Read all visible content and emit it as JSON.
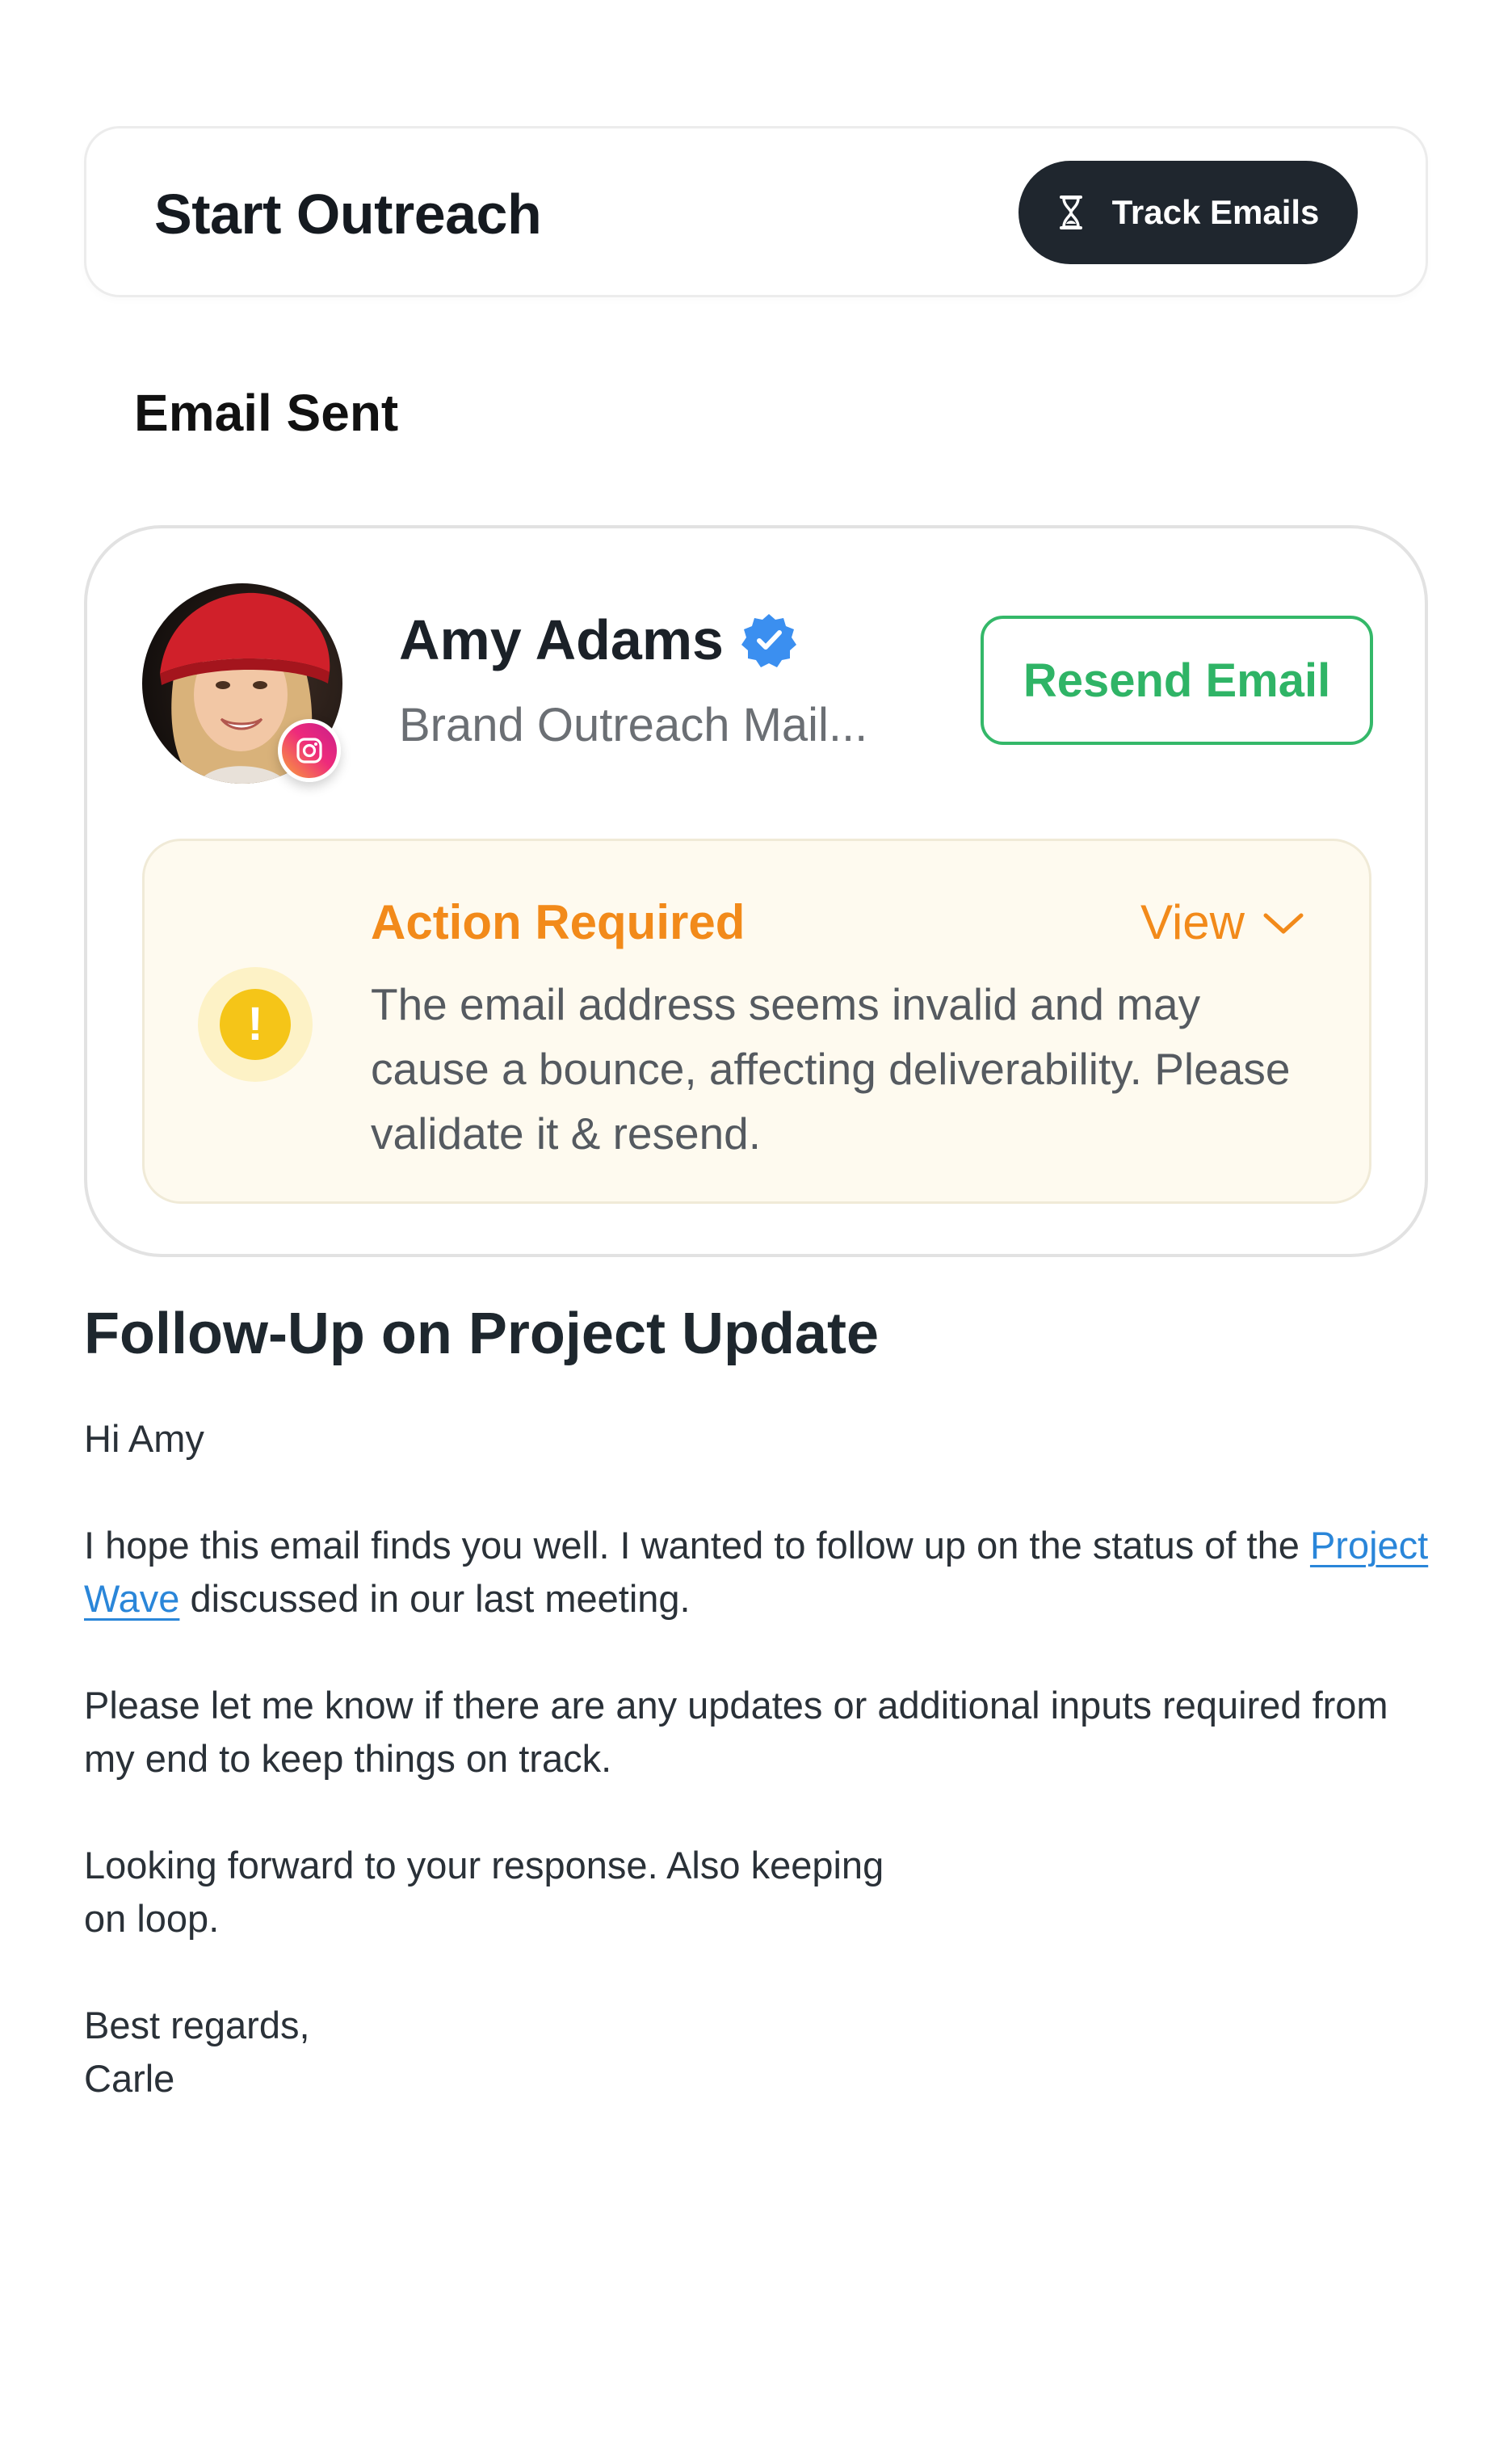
{
  "header": {
    "title": "Start Outreach",
    "track_button": {
      "label": "Track Emails",
      "icon": "hourglass-icon"
    }
  },
  "section_title": "Email Sent",
  "contact": {
    "name": "Amy Adams",
    "verified_icon": "verified-badge-icon",
    "subtitle": "Brand Outreach Mail...",
    "platform_icon": "instagram-icon",
    "resend_label": "Resend Email"
  },
  "alert": {
    "title": "Action Required",
    "view_label": "View",
    "message": "The email address seems invalid and may cause a bounce, affecting deliverability. Please validate it & resend.",
    "icon": "exclamation-icon"
  },
  "email": {
    "subject": "Follow-Up on Project Update",
    "greeting": "Hi Amy",
    "p1_before": "I hope this email finds you well. I wanted to follow up on the status of the ",
    "p1_link": "Project Wave",
    "p1_after": " discussed in our last meeting.",
    "p2": "Please let me know if there are any updates or additional inputs required from my end to keep things on track.",
    "p3_line1": "Looking forward to your response. Also keeping",
    "p3_line2": "on loop.",
    "signoff": "Best regards,",
    "signature": "Carle"
  },
  "colors": {
    "dark_button": "#1f262e",
    "resend_green": "#2fb466",
    "alert_orange": "#f28a1a",
    "alert_background": "#fefaef",
    "warning_yellow": "#f5c518",
    "link_blue": "#2a86d9",
    "verified_blue": "#3b8ff0"
  }
}
